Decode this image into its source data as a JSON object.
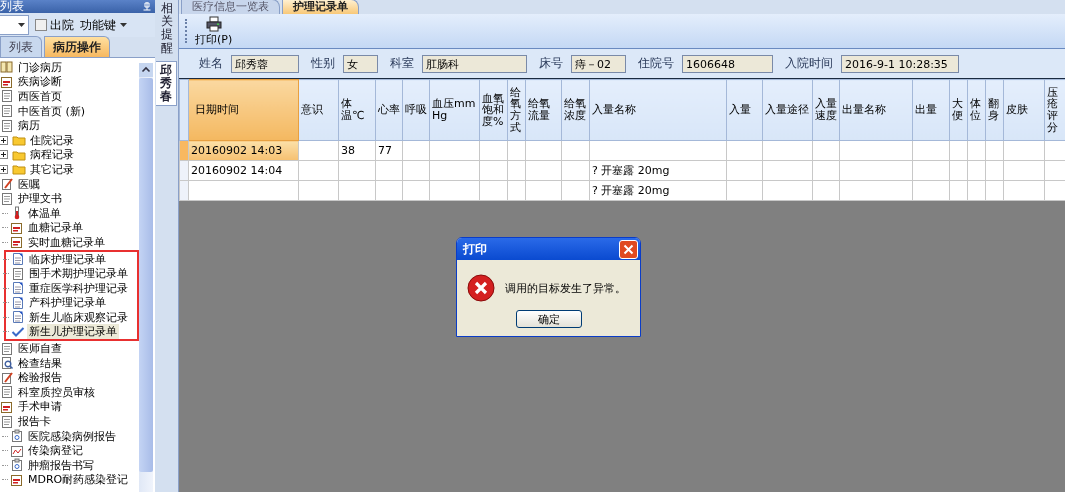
{
  "left_panel": {
    "title": "列表",
    "filter": {
      "discharged": {
        "label": "出院",
        "checked": false
      },
      "function_key": "功能键"
    },
    "tabs": [
      {
        "label": "列表",
        "selected": false
      },
      {
        "label": "病历操作",
        "selected": true
      }
    ],
    "tree": [
      {
        "label": "门诊病历",
        "kind": "book",
        "selected": false
      },
      {
        "label": "疾病诊断",
        "kind": "calendar",
        "selected": false
      },
      {
        "label": "西医首页",
        "kind": "page",
        "selected": false
      },
      {
        "label": "中医首页 (新)",
        "kind": "page",
        "selected": false
      },
      {
        "label": "病历",
        "kind": "page",
        "selected": false,
        "children": [
          {
            "label": "住院记录",
            "kind": "folder",
            "selected": false,
            "expanded": false
          },
          {
            "label": "病程记录",
            "kind": "folder",
            "selected": false,
            "expanded": false
          },
          {
            "label": "其它记录",
            "kind": "folder",
            "selected": false,
            "expanded": false
          }
        ]
      },
      {
        "label": "医嘱",
        "kind": "pen",
        "selected": false
      },
      {
        "label": "护理文书",
        "kind": "page",
        "selected": false,
        "children": [
          {
            "label": "体温单",
            "kind": "thermometer",
            "selected": false
          },
          {
            "label": "血糖记录单",
            "kind": "calendar",
            "selected": false
          },
          {
            "label": "实时血糖记录单",
            "kind": "calendar",
            "selected": false
          },
          {
            "label": "临床护理记录单",
            "kind": "doc",
            "selected": false,
            "highlighted": true
          },
          {
            "label": "围手术期护理记录单",
            "kind": "page",
            "selected": false,
            "highlighted": true
          },
          {
            "label": "重症医学科护理记录",
            "kind": "doc",
            "selected": false,
            "highlighted": true
          },
          {
            "label": "产科护理记录单",
            "kind": "doc",
            "selected": false,
            "highlighted": true
          },
          {
            "label": "新生儿临床观察记录",
            "kind": "doc",
            "selected": false,
            "highlighted": true
          },
          {
            "label": "新生儿护理记录单",
            "kind": "check",
            "selected": true,
            "highlighted": true
          }
        ]
      },
      {
        "label": "医师自查",
        "kind": "page",
        "selected": false
      },
      {
        "label": "检查结果",
        "kind": "search",
        "selected": false
      },
      {
        "label": "检验报告",
        "kind": "pen",
        "selected": false
      },
      {
        "label": "科室质控员审核",
        "kind": "page",
        "selected": false
      },
      {
        "label": "手术申请",
        "kind": "calendar",
        "selected": false
      },
      {
        "label": "报告卡",
        "kind": "page",
        "selected": false,
        "children": [
          {
            "label": "医院感染病例报告",
            "kind": "clipboard",
            "selected": false
          },
          {
            "label": "传染病登记",
            "kind": "chart",
            "selected": false
          },
          {
            "label": "肿瘤报告书写",
            "kind": "clipboard",
            "selected": false
          },
          {
            "label": "MDRO耐药感染登记",
            "kind": "calendar",
            "selected": false
          }
        ]
      }
    ]
  },
  "side_tabs": [
    {
      "label": "相关提醒",
      "selected": false
    },
    {
      "label": "邱秀春",
      "selected": true
    }
  ],
  "main_tabs": [
    {
      "label": "医疗信息一览表",
      "selected": false
    },
    {
      "label": "护理记录单",
      "selected": true
    }
  ],
  "toolbar": {
    "print_button": "打印(P)"
  },
  "patient": [
    {
      "label": "姓名",
      "value": "邱秀蓉"
    },
    {
      "label": "性别",
      "value": "女"
    },
    {
      "label": "科室",
      "value": "肛肠科"
    },
    {
      "label": "床号",
      "value": "痔－02"
    },
    {
      "label": "住院号",
      "value": "1606648"
    },
    {
      "label": "入院时间",
      "value": "2016-9-1 10:28:35"
    }
  ],
  "table": {
    "columns": [
      "日期时间",
      "意识",
      "体温℃",
      "心率",
      "呼吸",
      "血压mmHg",
      "血氧饱和度%",
      "给氧方式",
      "给氧流量",
      "给氧浓度",
      "入量名称",
      "入量",
      "入量途径",
      "入量速度",
      "出量名称",
      "出量",
      "大便",
      "体位",
      "翻身",
      "皮肤",
      "压疮评分"
    ],
    "rows": [
      {
        "selected": true,
        "cells": [
          "20160902 14:03",
          null,
          "38",
          "77",
          null,
          null,
          null,
          null,
          null,
          null,
          null,
          null,
          null,
          null,
          null,
          null,
          null,
          null,
          null,
          null,
          null
        ]
      },
      {
        "selected": false,
        "cells": [
          "20160902 14:04",
          null,
          null,
          null,
          null,
          null,
          null,
          null,
          null,
          null,
          "? 开塞露 20mg",
          null,
          null,
          null,
          null,
          null,
          null,
          null,
          null,
          null,
          null
        ]
      },
      {
        "selected": false,
        "cells": [
          null,
          null,
          null,
          null,
          null,
          null,
          null,
          null,
          null,
          null,
          "? 开塞露 20mg",
          null,
          null,
          null,
          null,
          null,
          null,
          null,
          null,
          null,
          null
        ]
      }
    ]
  },
  "dialog": {
    "title": "打印",
    "message": "调用的目标发生了异常。",
    "ok_button": "确定"
  }
}
